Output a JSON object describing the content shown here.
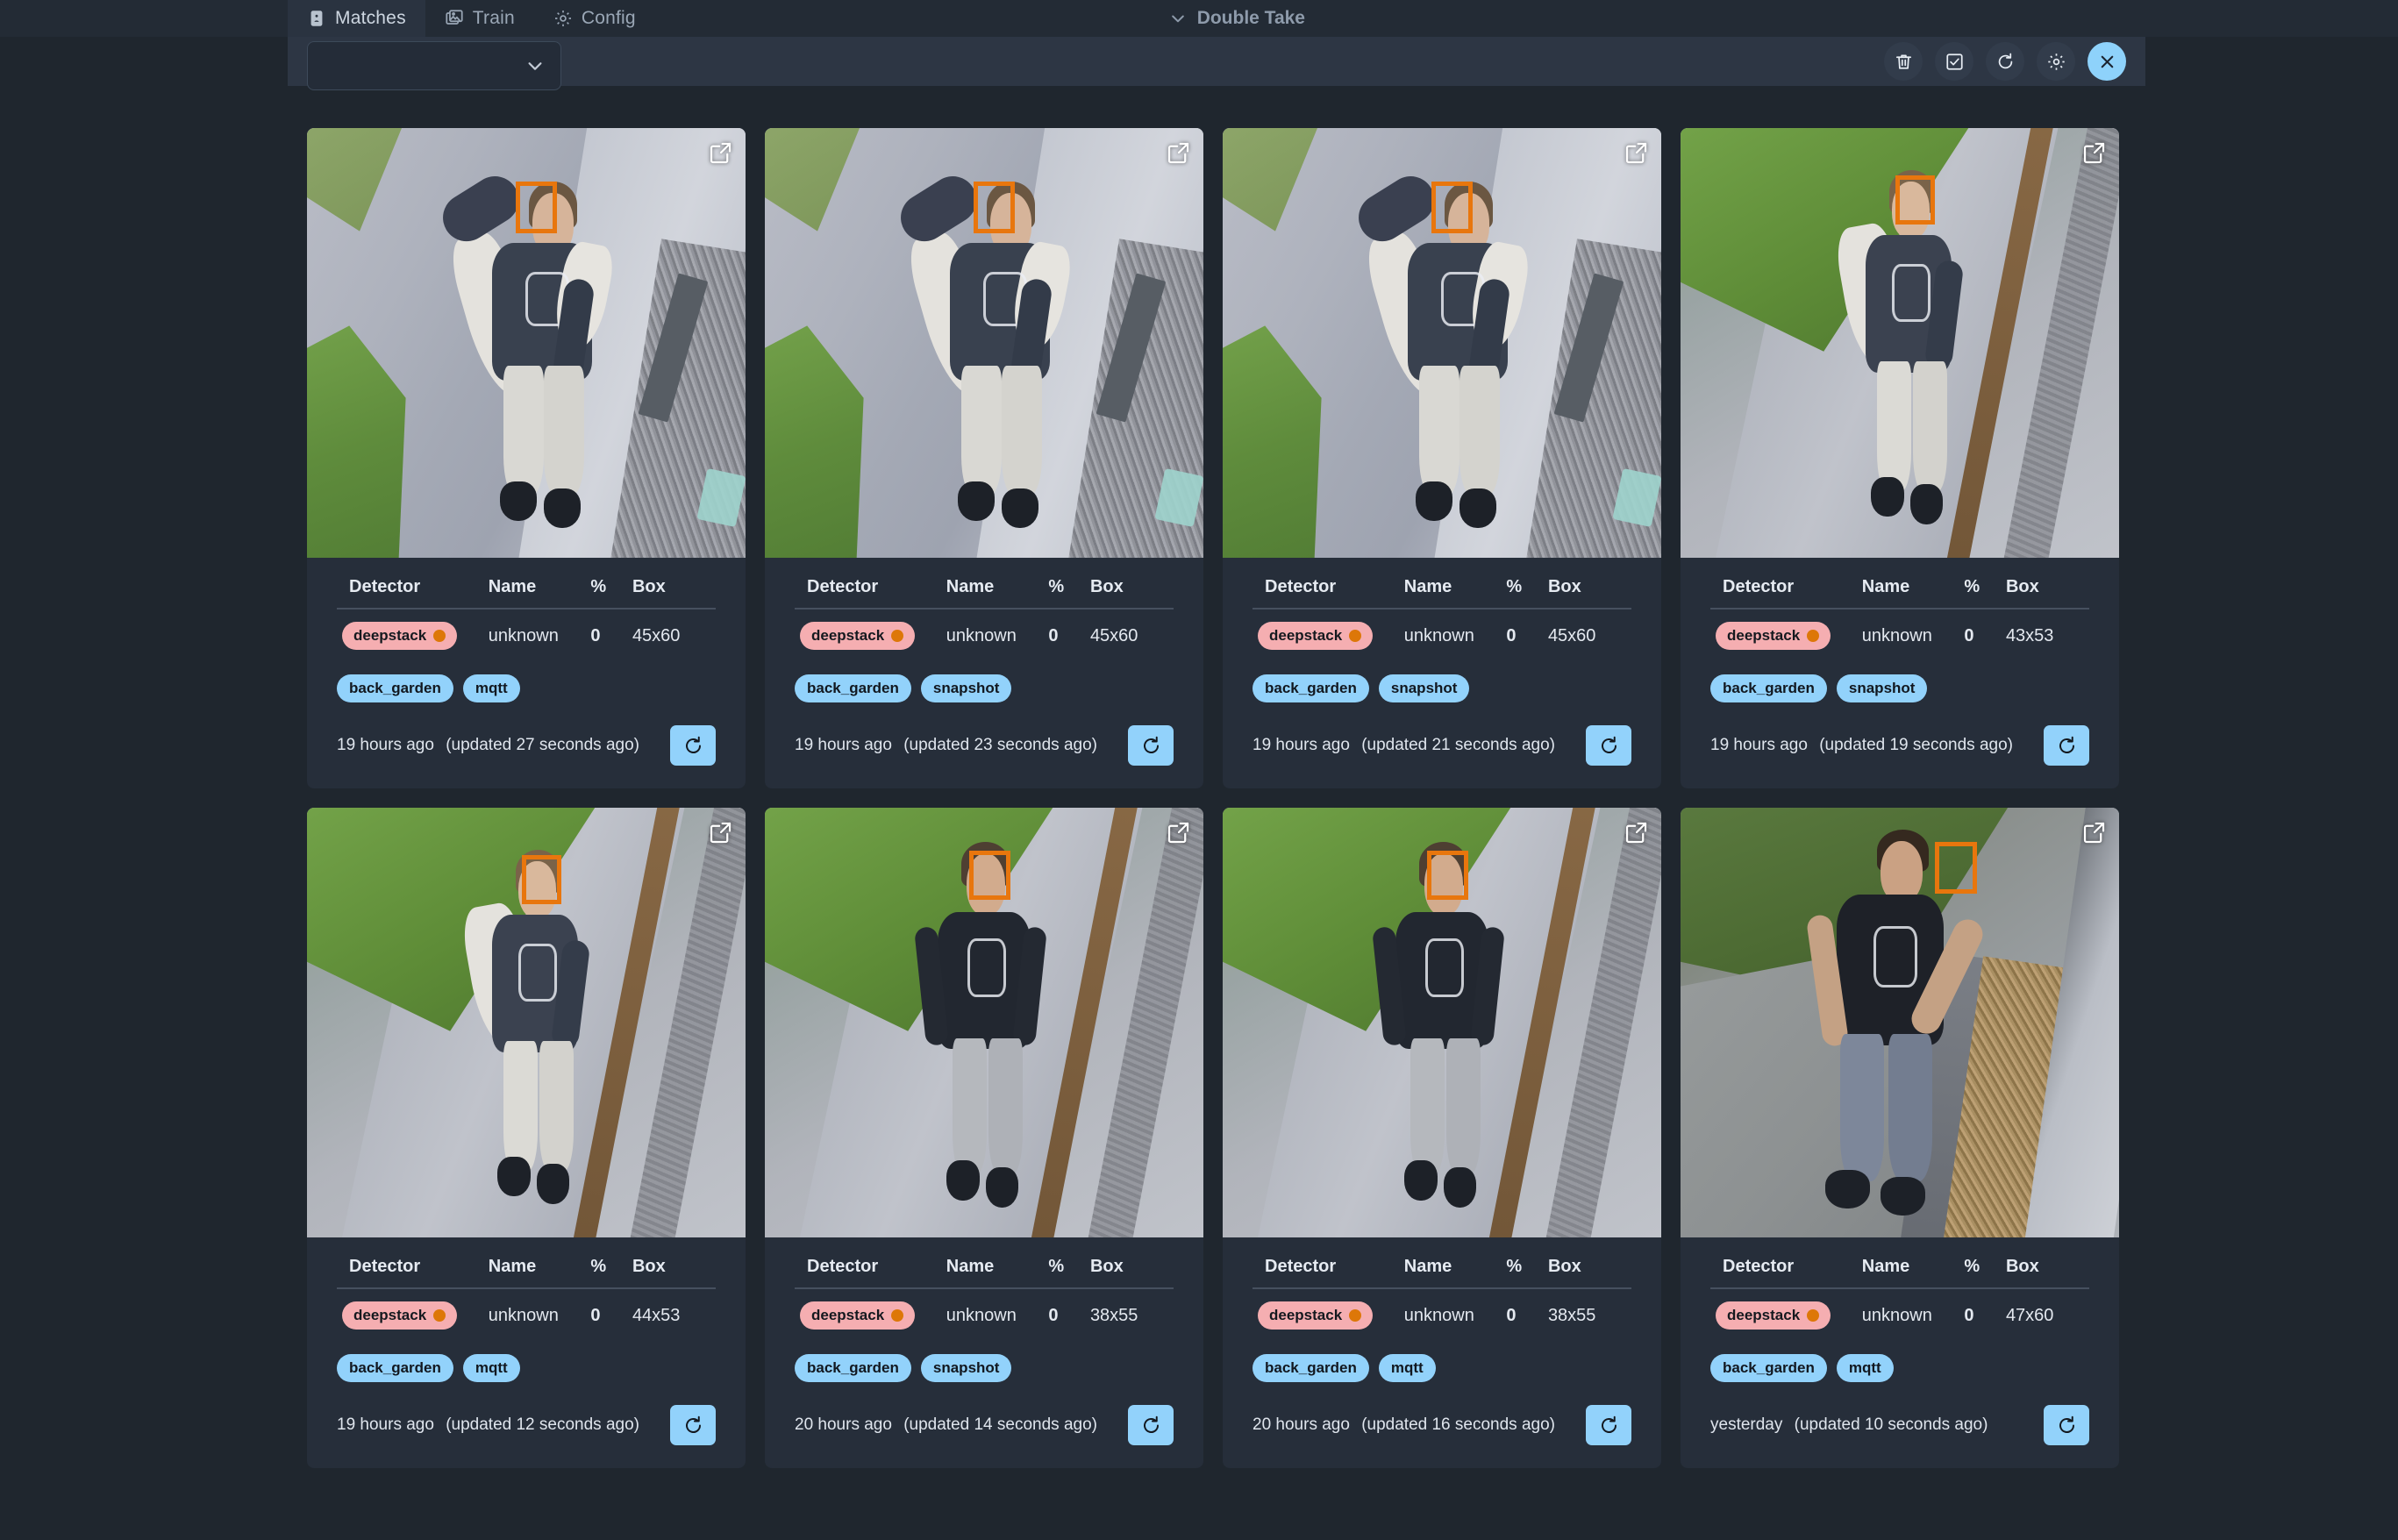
{
  "nav": {
    "tabs": [
      {
        "label": "Matches",
        "icon": "contact-card-icon",
        "active": true
      },
      {
        "label": "Train",
        "icon": "images-icon",
        "active": false
      },
      {
        "label": "Config",
        "icon": "gear-icon",
        "active": false
      }
    ],
    "brand": "Double Take",
    "brand_icon": "chevron-down-icon"
  },
  "toolbar": {
    "filter_select_value": "",
    "filter_select_icon": "chevron-down-icon",
    "actions": [
      {
        "name": "delete-button",
        "icon": "trash-icon",
        "label": "Delete"
      },
      {
        "name": "select-all-button",
        "icon": "checkbox-checked-icon",
        "label": "Select All"
      },
      {
        "name": "refresh-button",
        "icon": "refresh-icon",
        "label": "Refresh"
      },
      {
        "name": "settings-button",
        "icon": "gear-icon",
        "label": "Settings"
      },
      {
        "name": "close-button",
        "icon": "close-icon",
        "label": "Close",
        "primary": true
      }
    ]
  },
  "table_headers": {
    "detector": "Detector",
    "name": "Name",
    "percent": "%",
    "box": "Box"
  },
  "colors": {
    "page_bg": "#1f262e",
    "nav_bg": "#232b35",
    "toolbar_bg": "#2d3644",
    "card_bg": "#262e3a",
    "accent_blue": "#92d2fb",
    "detector_pill": "#f5aeb1",
    "detector_dot": "#dd7708",
    "percent_text": "#f08b90",
    "facebox": "#e8760d"
  },
  "cards": [
    {
      "scene": "A",
      "detector": "deepstack",
      "name": "unknown",
      "percent": "0",
      "box": "45x60",
      "tags": [
        "back_garden",
        "mqtt"
      ],
      "time": "19 hours ago",
      "updated": "(updated 27 seconds ago)",
      "ext_icon": "external-link-icon",
      "refresh_icon": "refresh-icon"
    },
    {
      "scene": "A",
      "detector": "deepstack",
      "name": "unknown",
      "percent": "0",
      "box": "45x60",
      "tags": [
        "back_garden",
        "snapshot"
      ],
      "time": "19 hours ago",
      "updated": "(updated 23 seconds ago)",
      "ext_icon": "external-link-icon",
      "refresh_icon": "refresh-icon"
    },
    {
      "scene": "A",
      "detector": "deepstack",
      "name": "unknown",
      "percent": "0",
      "box": "45x60",
      "tags": [
        "back_garden",
        "snapshot"
      ],
      "time": "19 hours ago",
      "updated": "(updated 21 seconds ago)",
      "ext_icon": "external-link-icon",
      "refresh_icon": "refresh-icon"
    },
    {
      "scene": "B",
      "detector": "deepstack",
      "name": "unknown",
      "percent": "0",
      "box": "43x53",
      "tags": [
        "back_garden",
        "snapshot"
      ],
      "time": "19 hours ago",
      "updated": "(updated 19 seconds ago)",
      "ext_icon": "external-link-icon",
      "refresh_icon": "refresh-icon"
    },
    {
      "scene": "B",
      "detector": "deepstack",
      "name": "unknown",
      "percent": "0",
      "box": "44x53",
      "tags": [
        "back_garden",
        "mqtt"
      ],
      "time": "19 hours ago",
      "updated": "(updated 12 seconds ago)",
      "ext_icon": "external-link-icon",
      "refresh_icon": "refresh-icon"
    },
    {
      "scene": "B2",
      "detector": "deepstack",
      "name": "unknown",
      "percent": "0",
      "box": "38x55",
      "tags": [
        "back_garden",
        "snapshot"
      ],
      "time": "20 hours ago",
      "updated": "(updated 14 seconds ago)",
      "ext_icon": "external-link-icon",
      "refresh_icon": "refresh-icon"
    },
    {
      "scene": "B2",
      "detector": "deepstack",
      "name": "unknown",
      "percent": "0",
      "box": "38x55",
      "tags": [
        "back_garden",
        "mqtt"
      ],
      "time": "20 hours ago",
      "updated": "(updated 16 seconds ago)",
      "ext_icon": "external-link-icon",
      "refresh_icon": "refresh-icon"
    },
    {
      "scene": "C",
      "detector": "deepstack",
      "name": "unknown",
      "percent": "0",
      "box": "47x60",
      "tags": [
        "back_garden",
        "mqtt"
      ],
      "time": "yesterday",
      "updated": "(updated 10 seconds ago)",
      "ext_icon": "external-link-icon",
      "refresh_icon": "refresh-icon"
    }
  ]
}
